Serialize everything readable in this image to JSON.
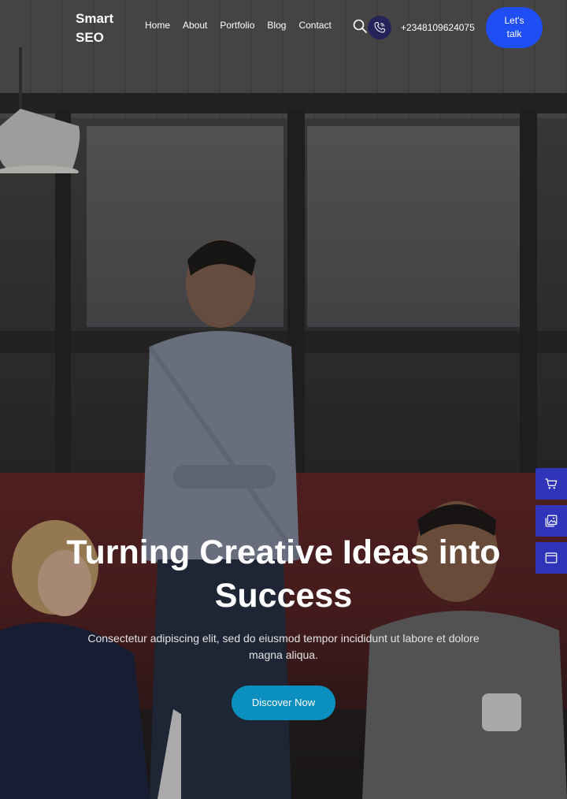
{
  "header": {
    "logo": "Smart SEO",
    "nav": [
      "Home",
      "About",
      "Portfolio",
      "Blog",
      "Contact"
    ],
    "phone": "+2348109624075",
    "cta": "Let's talk"
  },
  "hero": {
    "title": "Turning Creative Ideas into Success",
    "subtitle": "Consectetur adipiscing elit, sed do eiusmod tempor incididunt ut labore et dolore magna aliqua.",
    "button": "Discover Now"
  },
  "side_widgets": [
    "cart-icon",
    "gallery-icon",
    "browser-window-icon"
  ],
  "colors": {
    "accent": "#1f4ef5",
    "discover_button": "#0b8fc0",
    "phone_circle": "#25245a",
    "side_widget": "#2f34b8"
  }
}
